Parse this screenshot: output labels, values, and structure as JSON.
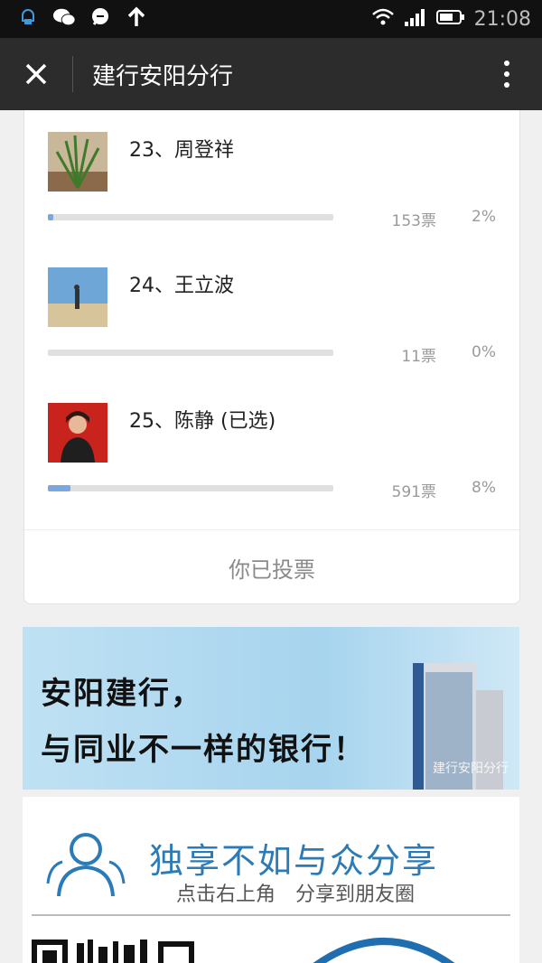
{
  "status_bar": {
    "time": "21:08",
    "icons": [
      "notification-icon",
      "wechat-icon",
      "message-icon",
      "upload-arrow-icon",
      "wifi-icon",
      "signal-icon",
      "battery-icon"
    ]
  },
  "nav": {
    "title": "建行安阳分行",
    "close_icon": "close-icon",
    "more_icon": "more-vertical-icon"
  },
  "vote": {
    "candidates": [
      {
        "name": "23、周登祥",
        "votes": "153票",
        "percent": "2%",
        "fill": 0.02
      },
      {
        "name": "24、王立波",
        "votes": "11票",
        "percent": "0%",
        "fill": 0.0
      },
      {
        "name": "25、陈静 (已选)",
        "votes": "591票",
        "percent": "8%",
        "fill": 0.08
      }
    ],
    "voted_label": "你已投票",
    "bar_color": "#7aa7e0"
  },
  "banner": {
    "line1": "安阳建行，",
    "line2": "与同业不一样的银行！",
    "watermark": "建行安阳分行"
  },
  "share": {
    "slogan": "独享不如与众分享",
    "sub": "点击右上角　分享到朋友圈",
    "accent": "#2a7bb8"
  }
}
